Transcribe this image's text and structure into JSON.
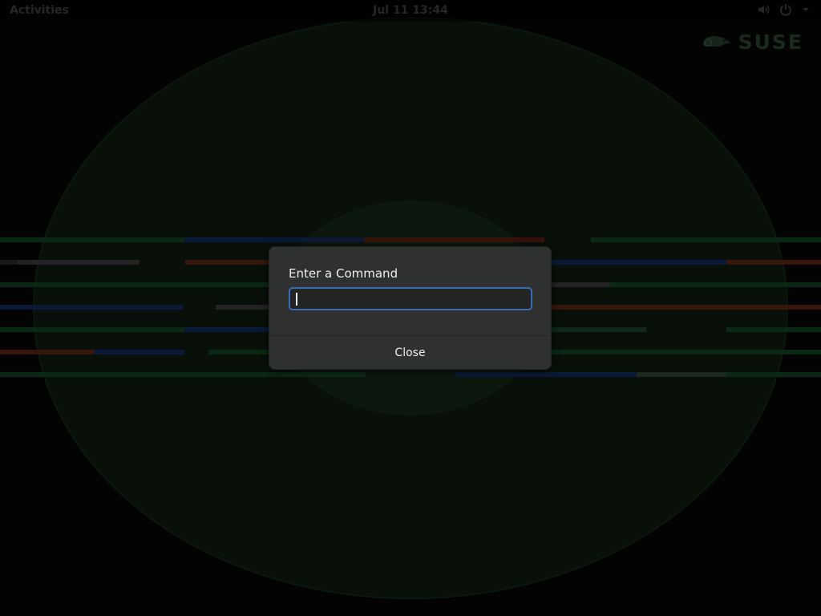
{
  "topbar": {
    "activities_label": "Activities",
    "clock": "Jul 11  13:44",
    "icons": [
      "volume-icon",
      "power-icon",
      "menu-arrow-icon"
    ]
  },
  "desktop": {
    "logo_text": "SUSE",
    "logo_icon": "chameleon-icon"
  },
  "run_dialog": {
    "title": "Enter a Command",
    "input_value": "",
    "close_label": "Close",
    "accent_color": "#3a6cb5"
  }
}
